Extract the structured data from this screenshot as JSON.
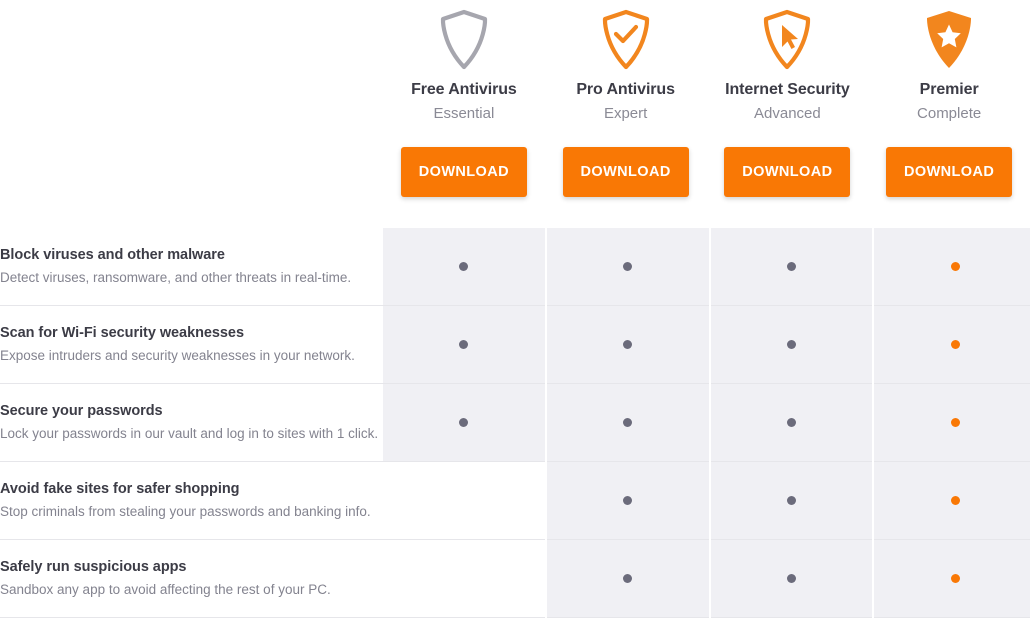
{
  "colors": {
    "accent": "#f97805",
    "dot_gray": "#6b6b7b",
    "column_shade": "#f0f0f4",
    "heading_text": "#3c3c46",
    "body_text": "#83838f"
  },
  "plans": [
    {
      "name": "Free Antivirus",
      "tier": "Essential",
      "icon": "shield-outline-icon",
      "cta": "DOWNLOAD"
    },
    {
      "name": "Pro Antivirus",
      "tier": "Expert",
      "icon": "shield-check-icon",
      "cta": "DOWNLOAD"
    },
    {
      "name": "Internet Security",
      "tier": "Advanced",
      "icon": "shield-cursor-icon",
      "cta": "DOWNLOAD"
    },
    {
      "name": "Premier",
      "tier": "Complete",
      "icon": "shield-star-icon",
      "cta": "DOWNLOAD"
    }
  ],
  "features": [
    {
      "title": "Block viruses and other malware",
      "description": "Detect viruses, ransomware, and other threats in real-time.",
      "availability": [
        true,
        true,
        true,
        true
      ]
    },
    {
      "title": "Scan for Wi-Fi security weaknesses",
      "description": "Expose intruders and security weaknesses in your network.",
      "availability": [
        true,
        true,
        true,
        true
      ]
    },
    {
      "title": "Secure your passwords",
      "description": "Lock your passwords in our vault and log in to sites with 1 click.",
      "availability": [
        true,
        true,
        true,
        true
      ]
    },
    {
      "title": "Avoid fake sites for safer shopping",
      "description": "Stop criminals from stealing your passwords and banking info.",
      "availability": [
        false,
        true,
        true,
        true
      ]
    },
    {
      "title": "Safely run suspicious apps",
      "description": "Sandbox any app to avoid affecting the rest of your PC.",
      "availability": [
        false,
        true,
        true,
        true
      ]
    }
  ]
}
